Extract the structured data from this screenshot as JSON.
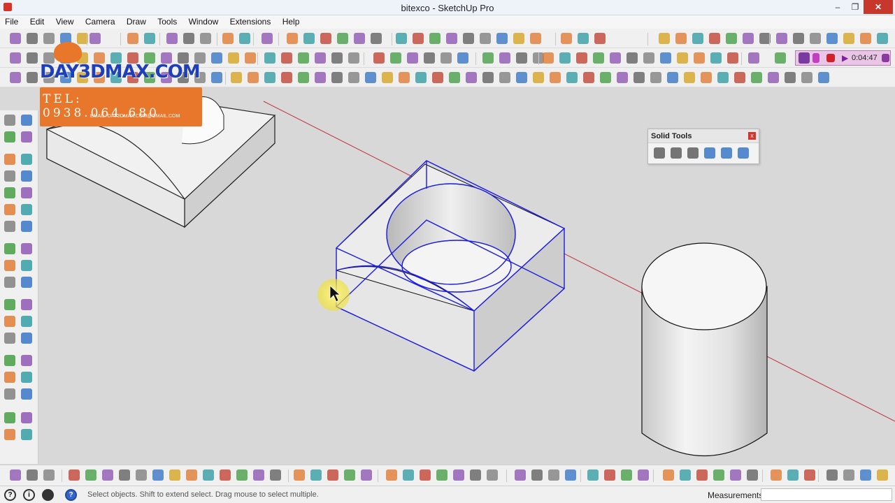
{
  "window": {
    "title": "bitexco - SketchUp Pro",
    "minimize": "–",
    "maximize": "❐",
    "close": "✕"
  },
  "menu": [
    "File",
    "Edit",
    "View",
    "Camera",
    "Draw",
    "Tools",
    "Window",
    "Extensions",
    "Help"
  ],
  "recorder": {
    "time": "0:04:47",
    "color": "#e9c6e6"
  },
  "solid_tools": {
    "title": "Solid Tools",
    "close": "x",
    "tool_count": 6
  },
  "watermark": {
    "brand": "DAY3DMAX.COM",
    "phone": "TEL: 0938.064.680",
    "email": "EMAIL: DAY3DMAX.COM@GMAIL.COM"
  },
  "status": {
    "hint": "Select objects. Shift to extend select. Drag mouse to select multiple.",
    "measurements_label": "Measurements",
    "measurements_value": ""
  },
  "colors": {
    "selection": "#1a1ae6",
    "red_axis": "#c0303a",
    "viewport_bg": "#d8d8d8"
  }
}
